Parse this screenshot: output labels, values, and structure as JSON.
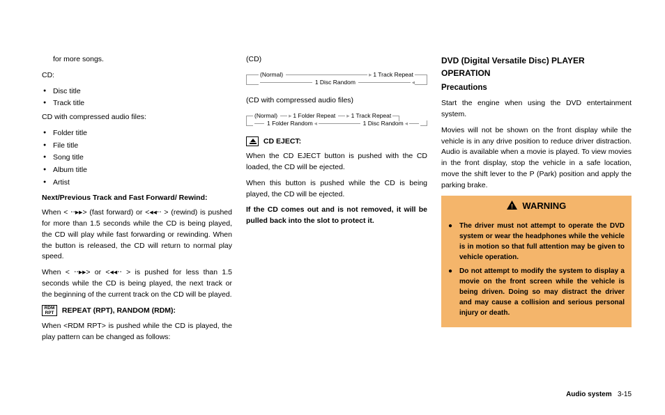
{
  "col1": {
    "cont1": "for more songs.",
    "cdLabel": "CD:",
    "cdList": [
      "Disc title",
      "Track title"
    ],
    "compLabel": "CD with compressed audio files:",
    "compList": [
      "Folder title",
      "File title",
      "Song title",
      "Album title",
      "Artist"
    ],
    "nextPrevHeading": "Next/Previous Track and Fast Forward/ Rewind:",
    "ffPara": "When < ⋅⋅▸▸> (fast forward) or <◂◂⋅⋅ > (rewind) is pushed for more than 1.5 seconds while the CD is being played, the CD will play while fast forwarding or rewinding. When the button is released, the CD will return to normal play speed.",
    "trackPara": "When < ⋅⋅▸▸> or <◂◂⋅⋅ > is pushed for less than 1.5 seconds while the CD is being played, the next track or the beginning of the current track on the CD will be played.",
    "rdmBtn1": "RDM",
    "rdmBtn2": "RPT",
    "rptHeading": "REPEAT (RPT), RANDOM (RDM):",
    "rptPara": "When <RDM RPT> is pushed while the CD is played, the play pattern can be changed as follows:"
  },
  "col2": {
    "cdParen": "(CD)",
    "diag1": {
      "normal": "(Normal)",
      "trackRepeat": "1 Track Repeat",
      "discRandom": "1 Disc Random"
    },
    "compParen": "(CD with compressed audio files)",
    "diag2": {
      "normal": "(Normal)",
      "folderRepeat": "1 Folder Repeat",
      "trackRepeat": "1 Track Repeat",
      "folderRandom": "1 Folder Random",
      "discRandom": "1 Disc Random"
    },
    "ejectHeading": "CD EJECT:",
    "ejectPara1": "When the CD EJECT button is pushed with the CD loaded, the CD will be ejected.",
    "ejectPara2": "When this button is pushed while the CD is being played, the CD will be ejected.",
    "ejectBold": "If the CD comes out and is not removed, it will be pulled back into the slot to protect it."
  },
  "col3": {
    "h2": "DVD (Digital Versatile Disc) PLAYER OPERATION",
    "h3": "Precautions",
    "p1": "Start the engine when using the DVD entertainment system.",
    "p2": "Movies will not be shown on the front display while the vehicle is in any drive position to reduce driver distraction. Audio is available when a movie is played. To view movies in the front display, stop the vehicle in a safe location, move the shift lever to the P (Park) position and apply the parking brake.",
    "warnTitle": "WARNING",
    "warn1": "The driver must not attempt to operate the DVD system or wear the headphones while the vehicle is in motion so that full attention may be given to vehicle operation.",
    "warn2": "Do not attempt to modify the system to display a movie on the front screen while the vehicle is being driven. Doing so may distract the driver and may cause a collision and serious personal injury or death."
  },
  "footer": {
    "section": "Audio system",
    "pageno": "3-15"
  }
}
